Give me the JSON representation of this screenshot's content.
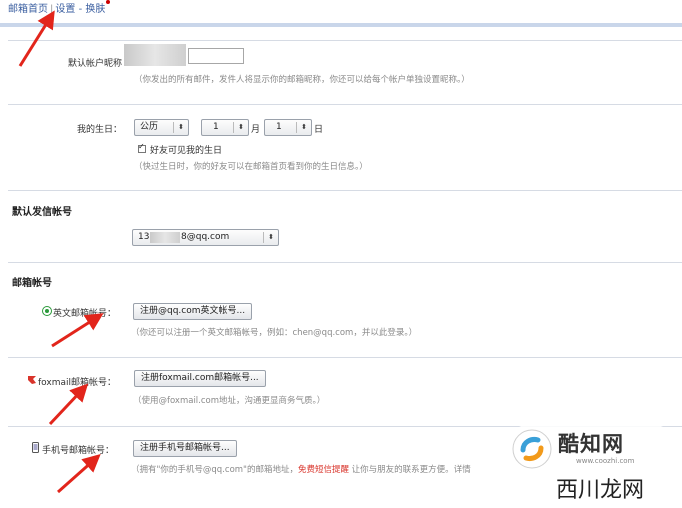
{
  "topnav": {
    "home": "邮箱首页",
    "sep": "|",
    "settings": "设置",
    "dash": "-",
    "skin": "换肤"
  },
  "nickname": {
    "label": "默认帐户昵称",
    "hint": "（你发出的所有邮件，发件人将显示你的邮箱昵称，你还可以给每个帐户单独设置昵称。）"
  },
  "birthday": {
    "label": "我的生日：",
    "calendar": "公历",
    "month_value": "1",
    "month_unit": "月",
    "day_value": "1",
    "day_unit": "日",
    "friends_visible": "好友可见我的生日",
    "hint": "（快过生日时，你的好友可以在邮箱首页看到你的生日信息。）"
  },
  "default_sender": {
    "heading": "默认发信帐号",
    "account_prefix": "13",
    "account_suffix": "8@qq.com"
  },
  "mail_accounts": {
    "heading": "邮箱帐号",
    "english": {
      "label": "英文邮箱帐号：",
      "button": "注册@qq.com英文帐号...",
      "hint": "（你还可以注册一个英文邮箱帐号，例如：chen@qq.com，并以此登录。）"
    },
    "foxmail": {
      "label": "foxmail邮箱帐号：",
      "button": "注册foxmail.com邮箱帐号...",
      "hint": "（使用@foxmail.com地址，沟通更显商务气质。）"
    },
    "mobile": {
      "label": "手机号邮箱帐号：",
      "button": "注册手机号邮箱帐号...",
      "hint_a": "（拥有\"你的手机号@qq.com\"的邮箱地址，",
      "hint_red": "免费短信提醒",
      "hint_b": " 让你与朋友的联系更方便。详情"
    }
  },
  "watermark": {
    "brand": "酷知网",
    "url": "www.coozhi.com",
    "corner": "西川龙网"
  },
  "colors": {
    "accent_red": "#d9342b",
    "link_blue": "#3b5fa0",
    "hint_gray": "#8a8a8a",
    "arrow_red": "#e2251b"
  }
}
